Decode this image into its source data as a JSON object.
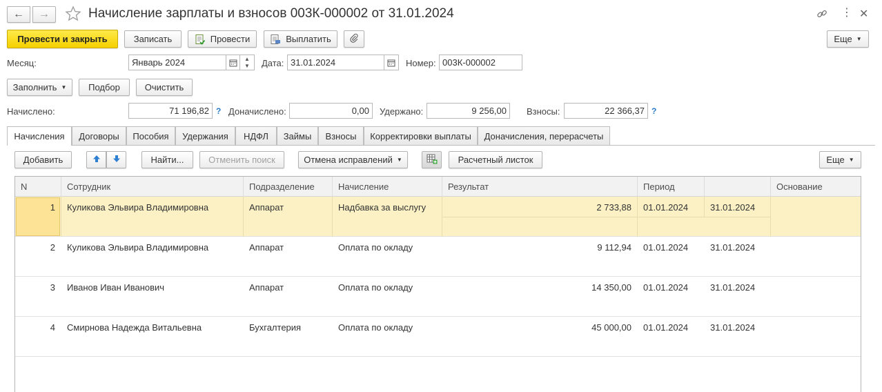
{
  "title": "Начисление зарплаты и взносов 003К-000002 от 31.01.2024",
  "nav": {
    "back": "←",
    "forward": "→"
  },
  "toolbar": {
    "post_close": "Провести и закрыть",
    "save": "Записать",
    "post": "Провести",
    "pay": "Выплатить",
    "more": "Еще"
  },
  "form": {
    "month_label": "Месяц:",
    "month_value": "Январь 2024",
    "date_label": "Дата:",
    "date_value": "31.01.2024",
    "number_label": "Номер:",
    "number_value": "003К-000002"
  },
  "actions": {
    "fill": "Заполнить",
    "select": "Подбор",
    "clear": "Очистить"
  },
  "totals": {
    "accrued_label": "Начислено:",
    "accrued_value": "71 196,82",
    "extra_label": "Доначислено:",
    "extra_value": "0,00",
    "withheld_label": "Удержано:",
    "withheld_value": "9 256,00",
    "contrib_label": "Взносы:",
    "contrib_value": "22 366,37",
    "help": "?"
  },
  "tabs": [
    "Начисления",
    "Договоры",
    "Пособия",
    "Удержания",
    "НДФЛ",
    "Займы",
    "Взносы",
    "Корректировки выплаты",
    "Доначисления, перерасчеты"
  ],
  "table_toolbar": {
    "add": "Добавить",
    "find": "Найти...",
    "cancel_search": "Отменить поиск",
    "undo_fix": "Отмена исправлений",
    "payslip": "Расчетный листок",
    "more": "Еще"
  },
  "columns": [
    "N",
    "Сотрудник",
    "Подразделение",
    "Начисление",
    "Результат",
    "Период",
    "",
    "Основание"
  ],
  "rows": [
    {
      "n": "1",
      "employee": "Куликова Эльвира Владимировна",
      "dept": "Аппарат",
      "accrual": "Надбавка за выслугу",
      "result": "2 733,88",
      "from": "01.01.2024",
      "to": "31.01.2024"
    },
    {
      "n": "2",
      "employee": "Куликова Эльвира Владимировна",
      "dept": "Аппарат",
      "accrual": "Оплата по окладу",
      "result": "9 112,94",
      "from": "01.01.2024",
      "to": "31.01.2024"
    },
    {
      "n": "3",
      "employee": "Иванов Иван Иванович",
      "dept": "Аппарат",
      "accrual": "Оплата по окладу",
      "result": "14 350,00",
      "from": "01.01.2024",
      "to": "31.01.2024"
    },
    {
      "n": "4",
      "employee": "Смирнова Надежда Витальевна",
      "dept": "Бухгалтерия",
      "accrual": "Оплата по окладу",
      "result": "45 000,00",
      "from": "01.01.2024",
      "to": "31.01.2024"
    }
  ],
  "colors": {
    "accent_yellow": "#f5d100",
    "selected_row": "#fbf1c4",
    "help_blue": "#2b7bc5"
  }
}
